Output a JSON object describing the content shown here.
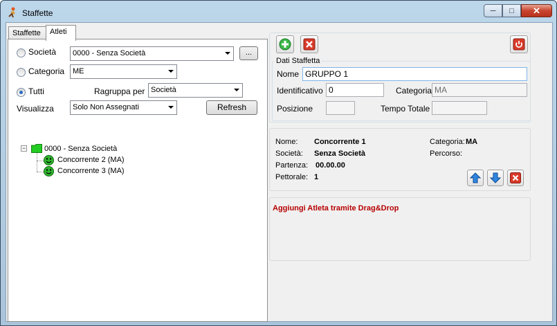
{
  "window": {
    "title": "Staffette",
    "min_glyph": "─",
    "max_glyph": "□",
    "close_glyph": "✕"
  },
  "tabs": [
    {
      "label": "Staffette"
    },
    {
      "label": "Atleti"
    }
  ],
  "filters": {
    "societa": {
      "label": "Società",
      "selected": false,
      "value": "0000 - Senza Società",
      "browse_label": "..."
    },
    "categoria": {
      "label": "Categoria",
      "selected": false,
      "value": "ME"
    },
    "tutti": {
      "label": "Tutti",
      "selected": true
    },
    "raggruppa": {
      "label": "Ragruppa per",
      "value": "Società"
    },
    "visualizza": {
      "label": "Visualizza",
      "value": "Solo Non Assegnati"
    },
    "refresh_label": "Refresh"
  },
  "tree": {
    "root": {
      "expander": "−",
      "label": "0000 - Senza Società"
    },
    "children": [
      {
        "label": "Concorrente 2 (MA)"
      },
      {
        "label": "Concorrente 3 (MA)"
      }
    ]
  },
  "toolbar": {
    "add_icon": "add-icon",
    "delete_icon": "delete-icon",
    "power_icon": "power-icon"
  },
  "dati": {
    "title": "Dati Staffetta",
    "nome_label": "Nome",
    "nome_value": "GRUPPO 1",
    "identificativo_label": "Identificativo",
    "identificativo_value": "0",
    "categoria_label": "Categoria",
    "categoria_value": "MA",
    "posizione_label": "Posizione",
    "posizione_value": "",
    "tempo_label": "Tempo Totale",
    "tempo_value": ""
  },
  "athlete": {
    "nome_label": "Nome:",
    "nome_value": "Concorrente 1",
    "societa_label": "Società:",
    "societa_value": "Senza Società",
    "partenza_label": "Partenza:",
    "partenza_value": "00.00.00",
    "pettorale_label": "Pettorale:",
    "pettorale_value": "1",
    "categoria_label": "Categoria:",
    "categoria_value": "MA",
    "percorso_label": "Percorso:",
    "percorso_value": ""
  },
  "dragdrop": {
    "hint": "Aggiungi Atleta tramite Drag&Drop"
  },
  "colors": {
    "accent_red": "#b70000",
    "green": "#2fb52f",
    "blue": "#2f86e0"
  }
}
